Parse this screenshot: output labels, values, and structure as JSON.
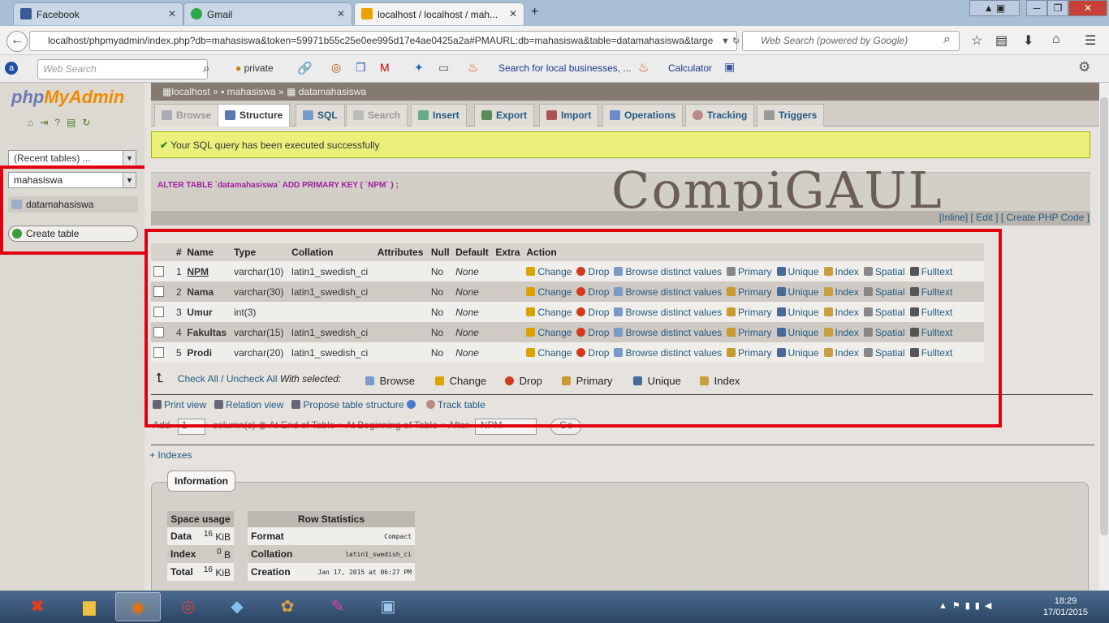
{
  "browser": {
    "tabs": [
      {
        "label": "Facebook",
        "color": "#3b5998"
      },
      {
        "label": "Gmail",
        "color": "#2aa84a"
      },
      {
        "label": "localhost / localhost / mah...",
        "color": "#e8a300"
      }
    ],
    "url": "localhost/phpmyadmin/index.php?db=mahasiswa&token=59971b55c25e0ee995d17e4ae0425a2a#PMAURL:db=mahasiswa&table=datamahasiswa&targe",
    "search_placeholder": "Web Search (powered by Google)",
    "bookmarks": {
      "web_search": "Web Search",
      "private": "private",
      "local_search": "Search for local businesses, ...",
      "calculator": "Calculator"
    }
  },
  "pma": {
    "logo_php": "php",
    "logo_myadmin": "MyAdmin",
    "recent_tables": "(Recent tables) ...",
    "db_select": "mahasiswa",
    "table_item": "datamahasiswa",
    "create_table": "Create table",
    "breadcrumb": {
      "server": "localhost",
      "db": "mahasiswa",
      "table": "datamahasiswa"
    },
    "tabs": [
      "Browse",
      "Structure",
      "SQL",
      "Search",
      "Insert",
      "Export",
      "Import",
      "Operations",
      "Tracking",
      "Triggers"
    ],
    "success_msg": "Your SQL query has been executed successfully",
    "sql_query": "ALTER TABLE `datamahasiswa` ADD PRIMARY KEY ( `NPM` ) ;",
    "sql_links": "[Inline] [ Edit ] [ Create PHP Code ]",
    "watermark": "CompiGAUL",
    "columns": [
      "#",
      "Name",
      "Type",
      "Collation",
      "Attributes",
      "Null",
      "Default",
      "Extra",
      "Action"
    ],
    "rows": [
      {
        "num": "1",
        "name": "NPM",
        "type": "varchar(10)",
        "collation": "latin1_swedish_ci",
        "null": "No",
        "default": "None"
      },
      {
        "num": "2",
        "name": "Nama",
        "type": "varchar(30)",
        "collation": "latin1_swedish_ci",
        "null": "No",
        "default": "None"
      },
      {
        "num": "3",
        "name": "Umur",
        "type": "int(3)",
        "collation": "",
        "null": "No",
        "default": "None"
      },
      {
        "num": "4",
        "name": "Fakultas",
        "type": "varchar(15)",
        "collation": "latin1_swedish_ci",
        "null": "No",
        "default": "None"
      },
      {
        "num": "5",
        "name": "Prodi",
        "type": "varchar(20)",
        "collation": "latin1_swedish_ci",
        "null": "No",
        "default": "None"
      }
    ],
    "actions": {
      "change": "Change",
      "drop": "Drop",
      "browse_distinct": "Browse distinct values",
      "primary": "Primary",
      "unique": "Unique",
      "index": "Index",
      "spatial": "Spatial",
      "fulltext": "Fulltext"
    },
    "check_all": "Check All / Uncheck All",
    "with_selected": "With selected:",
    "with_selected_actions": [
      "Browse",
      "Change",
      "Drop",
      "Primary",
      "Unique",
      "Index"
    ],
    "bottom_links": {
      "print_view": "Print view",
      "relation_view": "Relation view",
      "propose": "Propose table structure",
      "track": "Track table"
    },
    "add_row": {
      "add": "Add",
      "count": "1",
      "columns": "column(s)",
      "at_end": "At End of Table",
      "at_begin": "At Beginning of Table",
      "after": "After",
      "after_col": "NPM",
      "go": "Go"
    },
    "indexes": "+ Indexes",
    "information": "Information",
    "space_usage": {
      "title": "Space usage",
      "rows": [
        {
          "label": "Data",
          "value": "16",
          "unit": "KiB"
        },
        {
          "label": "Index",
          "value": "0",
          "unit": "B"
        },
        {
          "label": "Total",
          "value": "16",
          "unit": "KiB"
        }
      ]
    },
    "row_stats": {
      "title": "Row Statistics",
      "rows": [
        {
          "label": "Format",
          "value": "Compact"
        },
        {
          "label": "Collation",
          "value": "latin1_swedish_ci"
        },
        {
          "label": "Creation",
          "value": "Jan 17, 2015 at 06:27 PM"
        }
      ]
    }
  },
  "taskbar": {
    "time": "18:29",
    "date": "17/01/2015"
  }
}
